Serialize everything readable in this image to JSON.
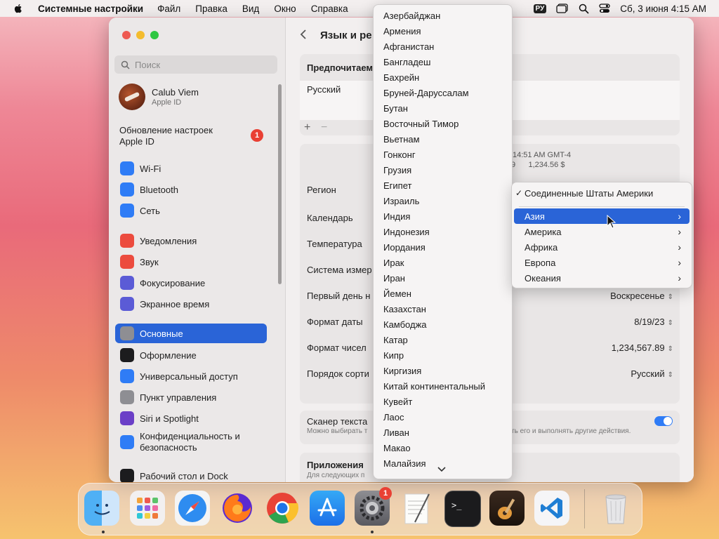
{
  "menubar": {
    "app_name": "Системные настройки",
    "items": [
      "Файл",
      "Правка",
      "Вид",
      "Окно",
      "Справка"
    ],
    "input_source": "РУ",
    "clock": "Сб, 3 июня  4:15 AM"
  },
  "sidebar": {
    "search_placeholder": "Поиск",
    "user_name": "Calub Viem",
    "user_sub": "Apple ID",
    "update_label": "Обновление настроек Apple ID",
    "update_badge": "1",
    "items": [
      {
        "label": "Wi-Fi",
        "icon": "wifi-icon",
        "color": "#2f7cf6"
      },
      {
        "label": "Bluetooth",
        "icon": "bluetooth-icon",
        "color": "#2f7cf6"
      },
      {
        "label": "Сеть",
        "icon": "globe-icon",
        "color": "#2f7cf6"
      },
      {
        "label": "Уведомления",
        "icon": "bell-icon",
        "color": "#ec4b3e"
      },
      {
        "label": "Звук",
        "icon": "speaker-icon",
        "color": "#ec4b3e"
      },
      {
        "label": "Фокусирование",
        "icon": "moon-icon",
        "color": "#5b5bd6"
      },
      {
        "label": "Экранное время",
        "icon": "hourglass-icon",
        "color": "#5b5bd6"
      },
      {
        "label": "Основные",
        "icon": "gear-icon",
        "color": "#8e8e93"
      },
      {
        "label": "Оформление",
        "icon": "appearance-icon",
        "color": "#1c1c1e"
      },
      {
        "label": "Универсальный доступ",
        "icon": "accessibility-icon",
        "color": "#2f7cf6"
      },
      {
        "label": "Пункт управления",
        "icon": "control-center-icon",
        "color": "#8e8e93"
      },
      {
        "label": "Siri и Spotlight",
        "icon": "siri-icon",
        "color": "#6b3fc7"
      },
      {
        "label": "Конфиденциальность и безопасность",
        "icon": "hand-icon",
        "color": "#2f7cf6"
      },
      {
        "label": "Рабочий стол и Dock",
        "icon": "desktop-icon",
        "color": "#1c1c1e"
      }
    ]
  },
  "content": {
    "title": "Язык и ре",
    "preferred_header": "Предпочитаем",
    "preferred_language": "Русский",
    "preview_time": "14:51 AM GMT-4",
    "preview_numbers": "9      1,234.56 $",
    "rows": [
      {
        "label": "Регион",
        "value": ""
      },
      {
        "label": "Календарь",
        "value": ""
      },
      {
        "label": "Температура",
        "value": ""
      },
      {
        "label": "Система измер",
        "value": ""
      },
      {
        "label": "Первый день н",
        "value": "Воскресенье"
      },
      {
        "label": "Формат даты",
        "value": "8/19/23"
      },
      {
        "label": "Формат чисел",
        "value": "1,234,567.89"
      },
      {
        "label": "Порядок сорти",
        "value": "Русский"
      }
    ],
    "scanner_label": "Сканер текста",
    "scanner_desc": "Можно выбирать т",
    "scanner_desc_tail": "ть его и выполнять другие действия.",
    "apps_header": "Приложения",
    "apps_desc": "Для следующих п",
    "plus": "+",
    "minus": "−"
  },
  "country_menu": {
    "items": [
      "Азербайджан",
      "Армения",
      "Афганистан",
      "Бангладеш",
      "Бахрейн",
      "Бруней-Даруссалам",
      "Бутан",
      "Восточный Тимор",
      "Вьетнам",
      "Гонконг",
      "Грузия",
      "Египет",
      "Израиль",
      "Индия",
      "Индонезия",
      "Иордания",
      "Ирак",
      "Иран",
      "Йемен",
      "Казахстан",
      "Камбоджа",
      "Катар",
      "Кипр",
      "Киргизия",
      "Китай континентальный",
      "Кувейт",
      "Лаос",
      "Ливан",
      "Макао",
      "Малайзия"
    ]
  },
  "region_menu": {
    "checked": "Соединенные Штаты Америки",
    "items": [
      "Азия",
      "Америка",
      "Африка",
      "Европа",
      "Океания"
    ],
    "highlighted": "Азия"
  },
  "dock": {
    "apps": [
      "Finder",
      "Launchpad",
      "Safari",
      "Firefox",
      "Chrome",
      "App Store",
      "System Settings",
      "TextEdit",
      "Terminal",
      "GarageBand",
      "VS Code",
      "Trash"
    ],
    "settings_badge": "1"
  }
}
